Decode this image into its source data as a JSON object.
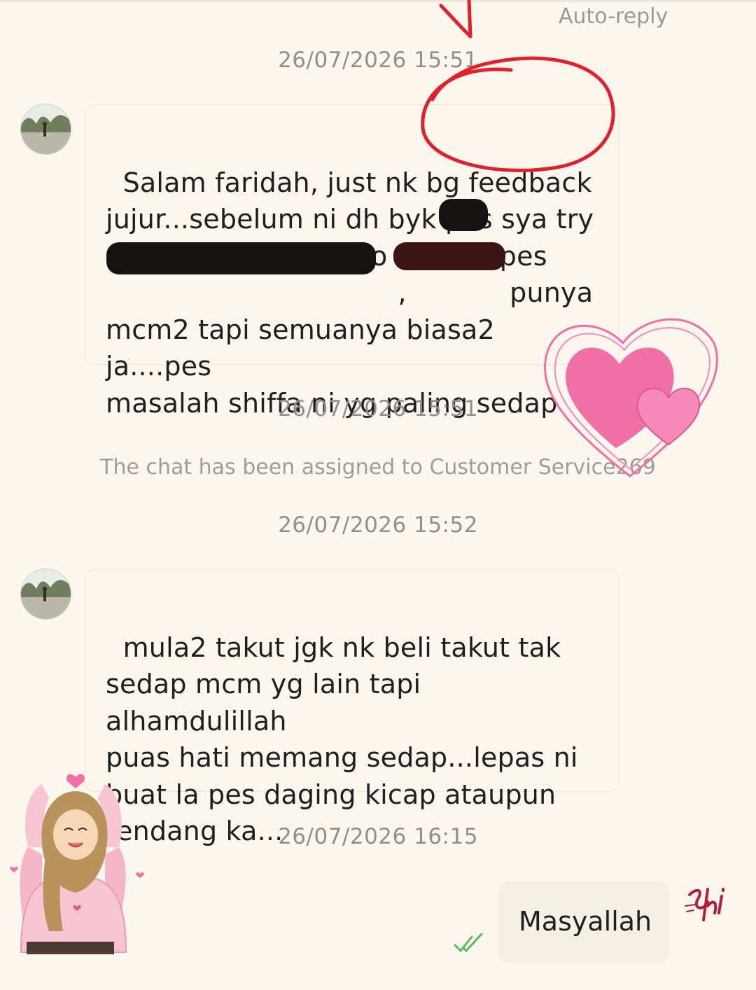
{
  "header": {
    "auto_reply_label": "Auto-reply"
  },
  "timestamps": {
    "t1": "26/07/2026 15:51",
    "t2": "26/07/2026 15:51",
    "t3": "26/07/2026 15:52",
    "t4": "26/07/2026 16:15"
  },
  "system_message": "The chat has been assigned to Customer Service269",
  "messages": {
    "m1": "Salam faridah, just nk bg feedback\njujur...sebelum ni dh byk pes sya try\nseperti food ready to eat     , pes\n                                  ,            punya\nmcm2 tapi semuanya biasa2 ja....pes\nmasalah shiffa ni yg paling sedap",
    "m2": "mula2 takut jgk nk beli takut tak\nsedap mcm yg lain tapi alhamdulillah\npuas hati memang sedap...lepas ni\nbuat la pes daging kicap ataupun\nrendang ka...",
    "outgoing": "Masyallah"
  },
  "status": {
    "read_receipt_icon": "double-check-icon",
    "read_color": "#5cb85c"
  },
  "decor": {
    "signature": "Shi",
    "annotation_color": "#e0202a",
    "heart_color": "#f06fa4"
  }
}
